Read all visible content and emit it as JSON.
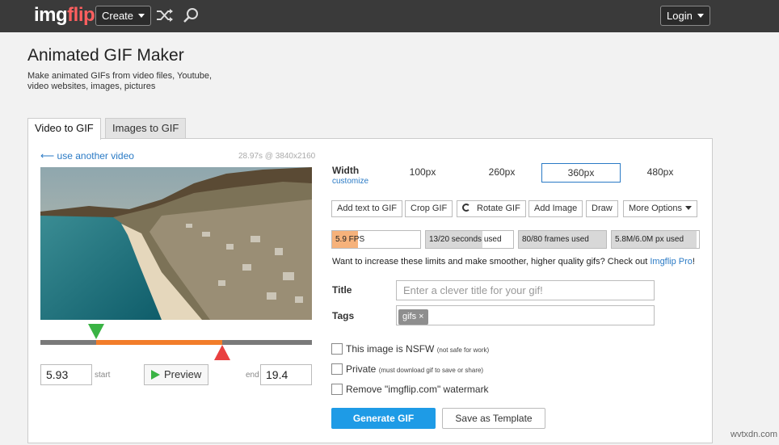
{
  "topbar": {
    "logo_a": "img",
    "logo_b": "flip",
    "create_label": "Create",
    "login_label": "Login",
    "icons": [
      "shuffle-icon",
      "search-icon"
    ]
  },
  "page": {
    "title": "Animated GIF Maker",
    "description": "Make animated GIFs from video files, Youtube, video websites, images, pictures"
  },
  "tabs": [
    {
      "label": "Video to GIF",
      "active": true
    },
    {
      "label": "Images to GIF",
      "active": false
    }
  ],
  "video": {
    "back_link": "⟵ use another video",
    "meta": "28.97s @ 3840x2160",
    "start_value": "5.93",
    "end_value": "19.4",
    "start_label": "start",
    "end_label": "end",
    "preview_label": "Preview",
    "selection_fraction": [
      0.205,
      0.67
    ]
  },
  "width": {
    "label": "Width",
    "customize": "customize",
    "options": [
      "100px",
      "260px",
      "360px",
      "480px"
    ],
    "selected": "360px"
  },
  "tools": [
    "Add text to GIF",
    "Crop GIF",
    "Rotate GIF",
    "Add Image",
    "Draw",
    "More Options"
  ],
  "limits": [
    {
      "label": "5.9 FPS",
      "fraction": 0.29,
      "color": "#f6b27b"
    },
    {
      "label": "13/20 seconds used",
      "fraction": 0.65,
      "color": "#d8d8d8"
    },
    {
      "label": "80/80 frames used",
      "fraction": 1.0,
      "color": "#d8d8d8"
    },
    {
      "label": "5.8M/6.0M px used",
      "fraction": 0.97,
      "color": "#d8d8d8"
    }
  ],
  "upsell": {
    "text": "Want to increase these limits and make smoother, higher quality gifs? Check out ",
    "link": "Imgflip Pro",
    "suffix": "!"
  },
  "form": {
    "title_label": "Title",
    "title_placeholder": "Enter a clever title for your gif!",
    "tags_label": "Tags",
    "tags": [
      "gifs ×"
    ]
  },
  "options": {
    "nsfw": "This image is NSFW",
    "nsfw_note": "(not safe for work)",
    "private": "Private",
    "private_note": "(must download gif to save or share)",
    "watermark": "Remove \"imgflip.com\" watermark"
  },
  "actions": {
    "generate": "Generate GIF",
    "template": "Save as Template"
  },
  "site_watermark": "wvtxdn.com"
}
